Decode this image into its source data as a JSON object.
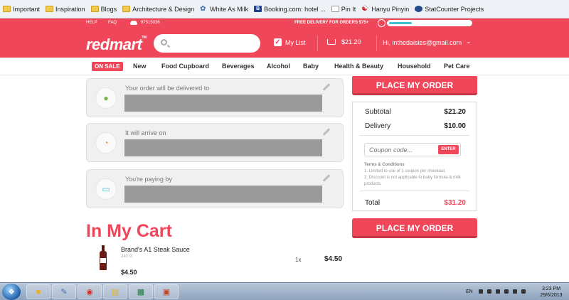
{
  "bookmarks": [
    {
      "label": "Important",
      "icon": "folder-icon"
    },
    {
      "label": "Inspiration",
      "icon": "folder-icon"
    },
    {
      "label": "Blogs",
      "icon": "folder-icon"
    },
    {
      "label": "Architecture & Design",
      "icon": "folder-icon"
    },
    {
      "label": "White As Milk",
      "icon": "white-as-milk-icon"
    },
    {
      "label": "Booking.com: hotel ...",
      "icon": "booking-icon"
    },
    {
      "label": "Pin It",
      "icon": "page-icon"
    },
    {
      "label": "Hanyu Pinyin",
      "icon": "hanyu-icon"
    },
    {
      "label": "StatCounter Projects",
      "icon": "statcounter-icon"
    }
  ],
  "topbar": {
    "help": "HELP",
    "faq": "FAQ",
    "phone": "97515036",
    "free_delivery": "FREE DELIVERY FOR ORDERS $75+",
    "delivery_progress": 0.28
  },
  "header": {
    "logo": "redmart",
    "search_placeholder": "",
    "my_list": "My List",
    "cart_total": "$21.20",
    "user": "Hi, inthedaisies@gmail.com"
  },
  "nav": {
    "on_sale": "ON SALE",
    "items": [
      "New",
      "Food Cupboard",
      "Beverages",
      "Alcohol",
      "Baby",
      "Health & Beauty",
      "Household",
      "Pet Care"
    ]
  },
  "info_cards": [
    {
      "label": "Your order will be delivered to",
      "icon": "map-pin-icon"
    },
    {
      "label": "It will arrive on",
      "icon": "clock-icon"
    },
    {
      "label": "You're paying by",
      "icon": "credit-card-icon"
    }
  ],
  "actions": {
    "place_order": "PLACE MY ORDER"
  },
  "summary": {
    "subtotal_label": "Subtotal",
    "subtotal": "$21.20",
    "delivery_label": "Delivery",
    "delivery": "$10.00",
    "coupon_placeholder": "Coupon code...",
    "enter": "ENTER",
    "terms_title": "Terms & Conditions",
    "terms_1": "1. Limited to use of 1 coupon per checkout.",
    "terms_2": "2. Discount is not applicable to baby formula & milk products.",
    "total_label": "Total",
    "total": "$31.20"
  },
  "cart": {
    "title": "In My Cart",
    "items": [
      {
        "name": "Brand's A1 Steak Sauce",
        "weight": "240 G",
        "qty": "1x",
        "price": "$4.50",
        "subtotal": "$4.50"
      }
    ]
  },
  "taskbar": {
    "apps": [
      "folder-icon",
      "paint-icon",
      "chrome-icon",
      "files-icon",
      "excel-icon",
      "powerpoint-icon"
    ],
    "lang": "EN",
    "time": "3:23 PM",
    "date": "29/6/2013"
  },
  "colors": {
    "brand": "#f0465a",
    "progress": "#43c0d4"
  }
}
